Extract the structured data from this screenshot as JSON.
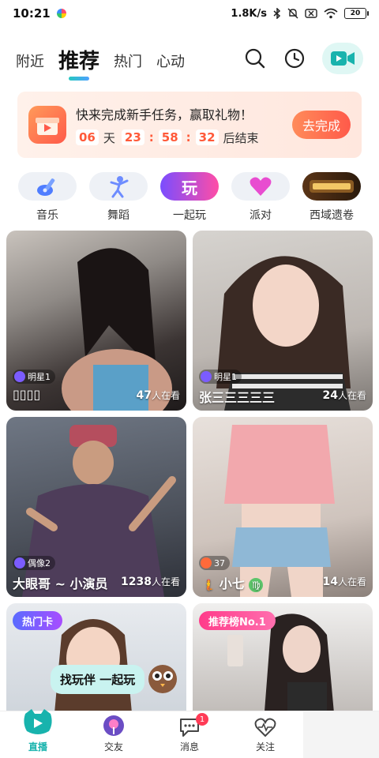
{
  "status_bar": {
    "time": "10:21",
    "net_speed": "1.8K/s",
    "battery": "20"
  },
  "top_nav": {
    "tabs": [
      {
        "label": "附近",
        "active": false
      },
      {
        "label": "推荐",
        "active": true
      },
      {
        "label": "热门",
        "active": false
      },
      {
        "label": "心动",
        "active": false
      }
    ]
  },
  "task_banner": {
    "title": "快来完成新手任务，赢取礼物！",
    "countdown": {
      "days": "06",
      "day_unit": "天",
      "hours": "23",
      "minutes": "58",
      "seconds": "32",
      "suffix": "后结束"
    },
    "button": "去完成"
  },
  "categories": [
    {
      "label": "音乐",
      "icon": "guitar-icon"
    },
    {
      "label": "舞蹈",
      "icon": "dancer-icon"
    },
    {
      "label": "一起玩",
      "icon": "play-together-icon",
      "pill_text": "玩"
    },
    {
      "label": "派对",
      "icon": "heart-icon"
    },
    {
      "label": "西域遗卷",
      "icon": "game-banner-icon"
    }
  ],
  "cards": [
    {
      "badge": "明星1",
      "name": "▯▯▯▯",
      "viewer_count": "47",
      "viewer_suffix": "人在看"
    },
    {
      "badge": "明星1",
      "name": "张三三三三三",
      "viewer_count": "24",
      "viewer_suffix": "人在看"
    },
    {
      "badge": "偶像2",
      "name": "大眼哥 ~ 小演员",
      "viewer_count": "1238",
      "viewer_suffix": "人在看"
    },
    {
      "badge": "37",
      "name": "小七",
      "viewer_count": "14",
      "viewer_suffix": "人在看"
    },
    {
      "tag": "热门卡",
      "speech": "找玩伴 一起玩"
    },
    {
      "tag": "推荐榜No.1"
    }
  ],
  "bottom_nav": [
    {
      "label": "直播",
      "active": true
    },
    {
      "label": "交友",
      "active": false
    },
    {
      "label": "消息",
      "active": false,
      "badge": "1"
    },
    {
      "label": "关注",
      "active": false
    }
  ],
  "colors": {
    "accent": "#18b3ad",
    "banner_orange": "#ff5a3a"
  }
}
